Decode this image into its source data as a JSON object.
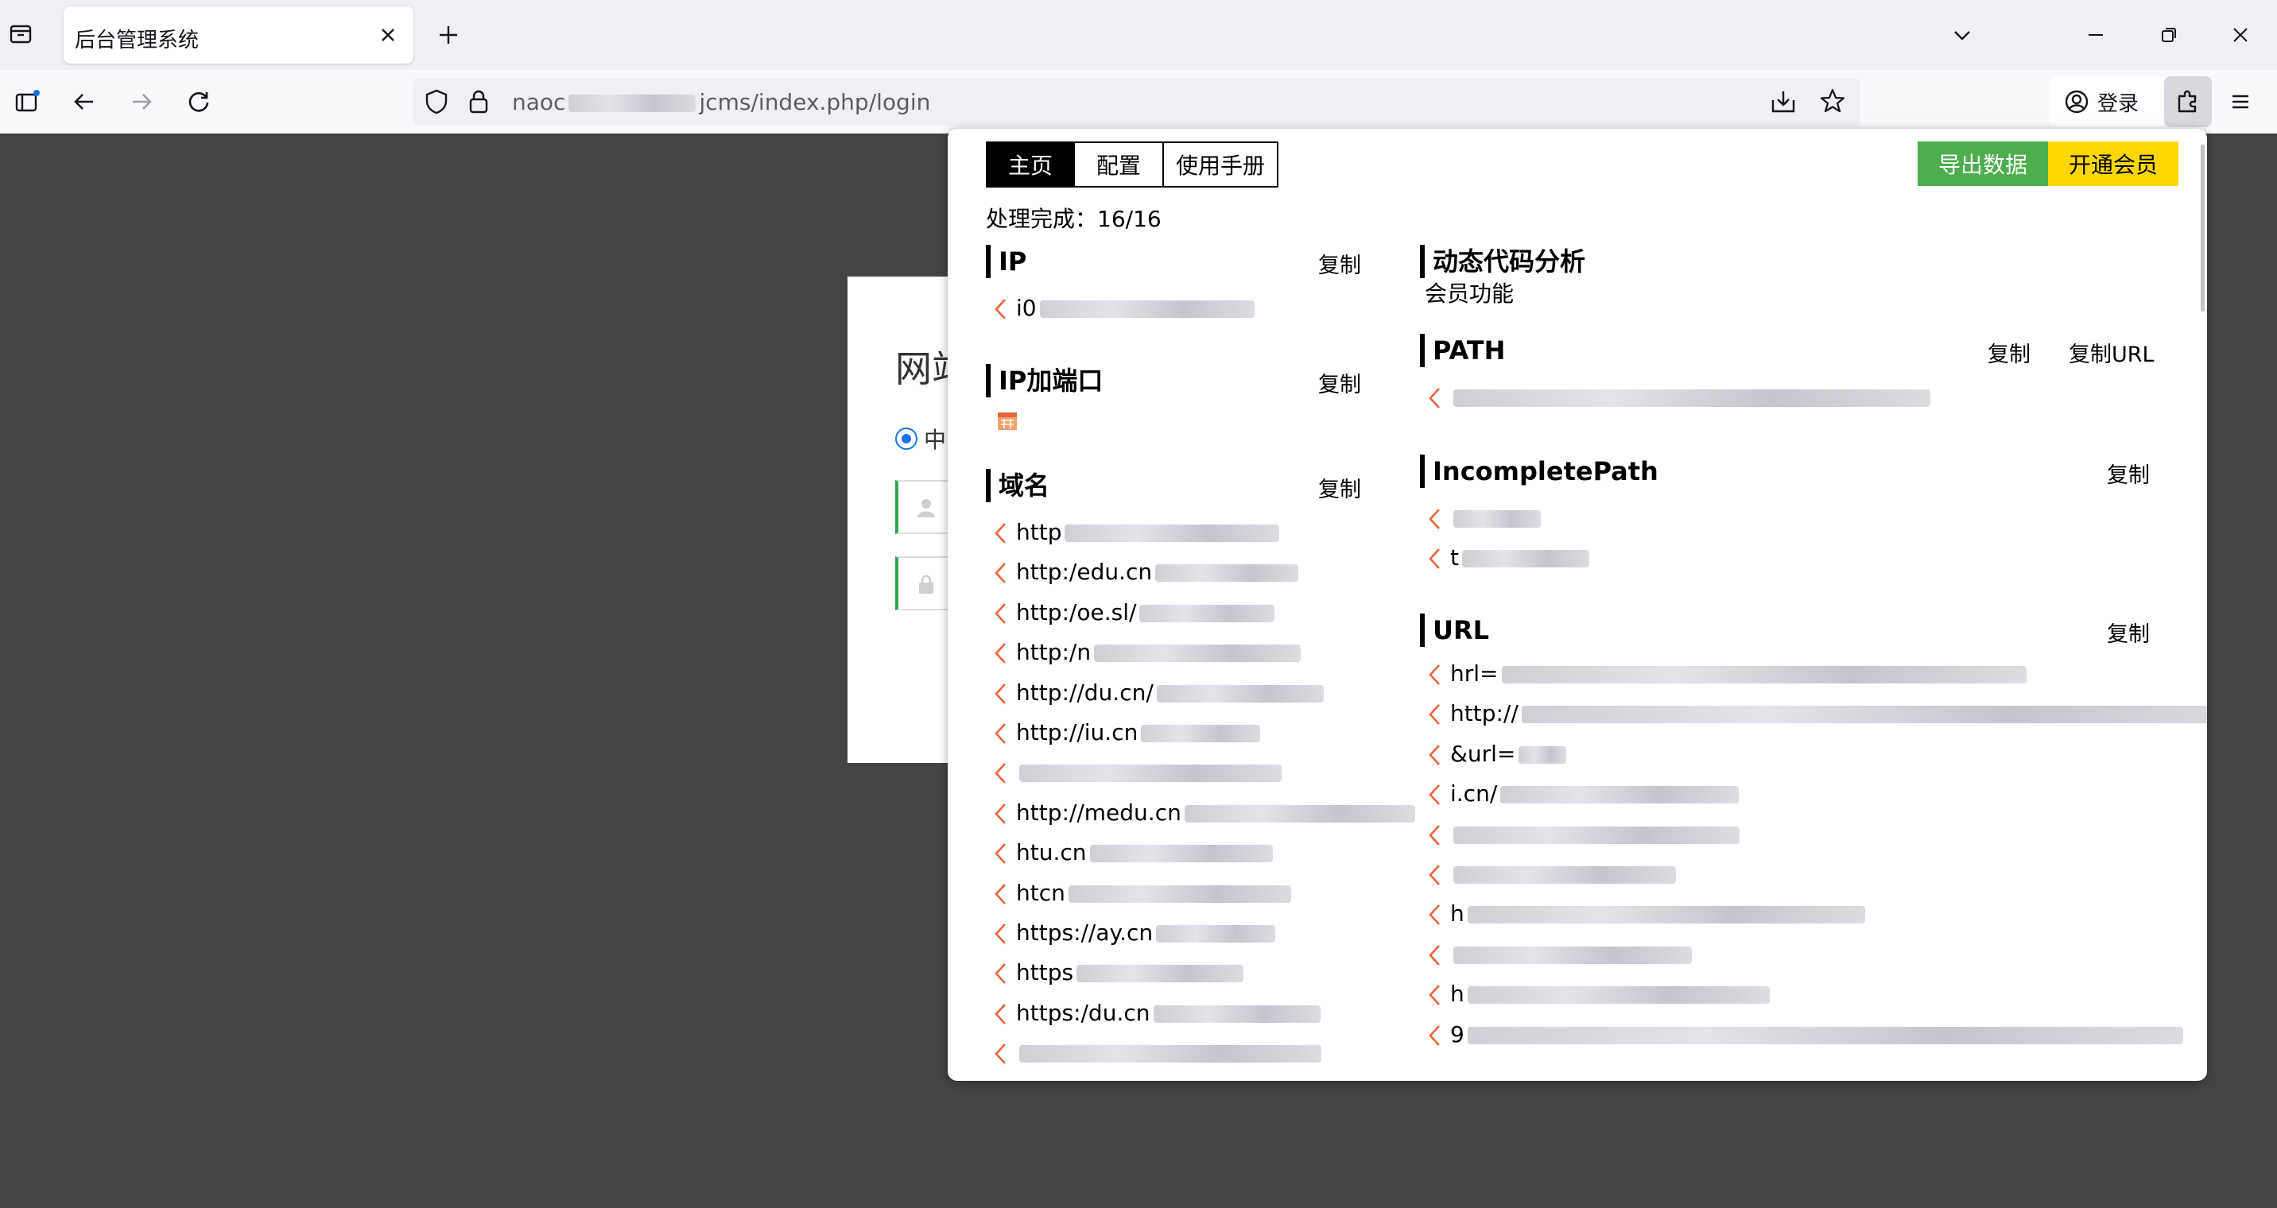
{
  "browser": {
    "tab_title": "后台管理系统",
    "url_prefix": "naoc",
    "url_suffix": "jcms/index.php/login",
    "signin_label": "登录"
  },
  "login_page": {
    "title_partial": "网站",
    "radio_label_partial": "中"
  },
  "popup": {
    "tabs": [
      "主页",
      "配置",
      "使用手册"
    ],
    "export_button": "导出数据",
    "vip_button": "开通会员",
    "status": "处理完成：16/16",
    "copy_label": "复制",
    "copy_url_label": "复制URL",
    "sections": {
      "ip": {
        "title": "IP",
        "items": [
          "i0"
        ]
      },
      "ip_port": {
        "title": "IP加端口"
      },
      "domain": {
        "title": "域名",
        "items": [
          "http",
          "http:/edu.cn",
          "http:/oe.sl/",
          "http:/n",
          "http://du.cn/",
          "http://iu.cn",
          "",
          "http://medu.cn",
          "htu.cn",
          "htcn",
          "https://ay.cn",
          "https",
          "https:/du.cn",
          ""
        ]
      },
      "dynamic": {
        "title": "动态代码分析",
        "member_text": "会员功能"
      },
      "path": {
        "title": "PATH",
        "items": [
          ""
        ]
      },
      "incomplete": {
        "title": "IncompletePath",
        "items": [
          "",
          "t"
        ]
      },
      "url": {
        "title": "URL",
        "items": [
          "hrl=",
          "http://",
          "&url=",
          "i.cn/",
          "",
          "",
          "h",
          "",
          "h",
          "9"
        ]
      }
    }
  },
  "colors": {
    "accent_green": "#4cae4c",
    "accent_yellow": "#ffd700",
    "chevron": "#e8663d",
    "overlay": "#444444"
  }
}
